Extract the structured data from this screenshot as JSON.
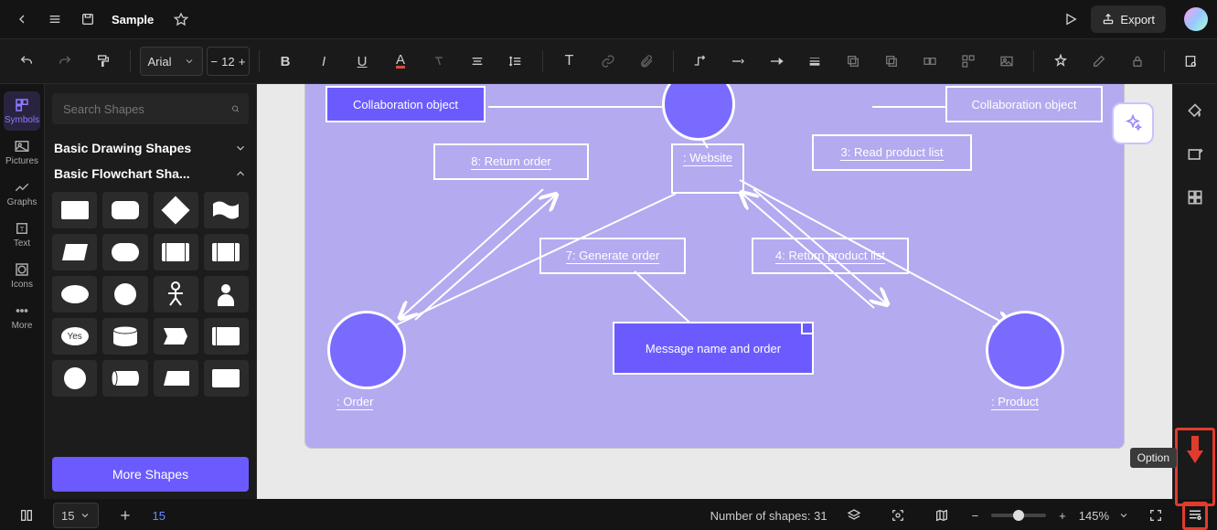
{
  "topbar": {
    "title": "Sample",
    "play_label": "Play",
    "export_label": "Export"
  },
  "toolbar": {
    "font": "Arial",
    "font_size": "12"
  },
  "rail": {
    "items": [
      {
        "label": "Symbols"
      },
      {
        "label": "Pictures"
      },
      {
        "label": "Graphs"
      },
      {
        "label": "Text"
      },
      {
        "label": "Icons"
      },
      {
        "label": "More"
      }
    ]
  },
  "shapes_panel": {
    "search_placeholder": "Search Shapes",
    "cat1": "Basic Drawing Shapes",
    "cat2": "Basic Flowchart Sha...",
    "decision_yes": "Yes",
    "more_shapes": "More Shapes"
  },
  "diagram": {
    "collab_left": "Collaboration object",
    "collab_right": "Collaboration object",
    "return_order": "8: Return order",
    "website": ": Website",
    "read_product": "3: Read product list",
    "generate_order": "7: Generate order",
    "return_product": "4: Return product list",
    "message_name": "Message name and order",
    "order_caption": ": Order",
    "product_caption": ": Product"
  },
  "right_rail": {
    "option_tooltip": "Option"
  },
  "footer": {
    "page_current": "15",
    "page_label": "15",
    "shapes_count": "Number of shapes: 31",
    "zoom": "145%"
  }
}
